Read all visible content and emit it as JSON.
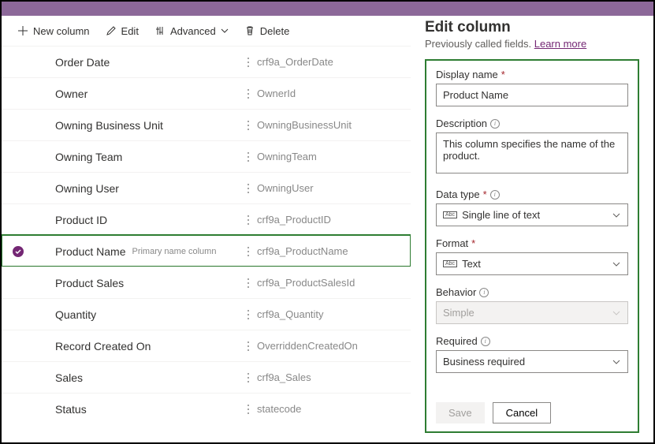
{
  "toolbar": {
    "new_column": "New column",
    "edit": "Edit",
    "advanced": "Advanced",
    "delete": "Delete"
  },
  "rows": [
    {
      "display": "Order Date",
      "logical": "crf9a_OrderDate",
      "selected": false,
      "primary": false
    },
    {
      "display": "Owner",
      "logical": "OwnerId",
      "selected": false,
      "primary": false
    },
    {
      "display": "Owning Business Unit",
      "logical": "OwningBusinessUnit",
      "selected": false,
      "primary": false
    },
    {
      "display": "Owning Team",
      "logical": "OwningTeam",
      "selected": false,
      "primary": false
    },
    {
      "display": "Owning User",
      "logical": "OwningUser",
      "selected": false,
      "primary": false
    },
    {
      "display": "Product ID",
      "logical": "crf9a_ProductID",
      "selected": false,
      "primary": false
    },
    {
      "display": "Product Name",
      "logical": "crf9a_ProductName",
      "selected": true,
      "primary": true
    },
    {
      "display": "Product Sales",
      "logical": "crf9a_ProductSalesId",
      "selected": false,
      "primary": false
    },
    {
      "display": "Quantity",
      "logical": "crf9a_Quantity",
      "selected": false,
      "primary": false
    },
    {
      "display": "Record Created On",
      "logical": "OverriddenCreatedOn",
      "selected": false,
      "primary": false
    },
    {
      "display": "Sales",
      "logical": "crf9a_Sales",
      "selected": false,
      "primary": false
    },
    {
      "display": "Status",
      "logical": "statecode",
      "selected": false,
      "primary": false
    }
  ],
  "primary_badge": "Primary name column",
  "panel": {
    "title": "Edit column",
    "subtitle_a": "Previously called fields. ",
    "subtitle_link": "Learn more",
    "display_name_label": "Display name",
    "display_name_value": "Product Name",
    "description_label": "Description",
    "description_value": "This column specifies the name of the product.",
    "data_type_label": "Data type",
    "data_type_value": "Single line of text",
    "format_label": "Format",
    "format_value": "Text",
    "behavior_label": "Behavior",
    "behavior_value": "Simple",
    "required_label": "Required",
    "required_value": "Business required",
    "save": "Save",
    "cancel": "Cancel"
  }
}
